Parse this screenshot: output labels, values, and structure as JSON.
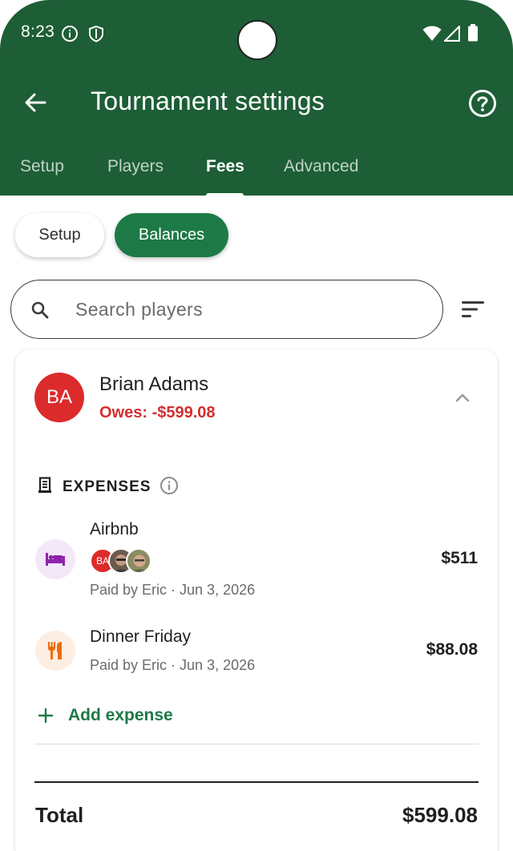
{
  "status_bar": {
    "time": "8:23"
  },
  "app_bar": {
    "title": "Tournament settings"
  },
  "tabs": [
    {
      "label": "Setup",
      "active": false
    },
    {
      "label": "Players",
      "active": false
    },
    {
      "label": "Fees",
      "active": true
    },
    {
      "label": "Advanced",
      "active": false
    }
  ],
  "segments": [
    {
      "label": "Setup",
      "selected": false
    },
    {
      "label": "Balances",
      "selected": true
    }
  ],
  "search": {
    "placeholder": "Search players",
    "value": ""
  },
  "player": {
    "initials": "BA",
    "name": "Brian Adams",
    "owes": "Owes: -$599.08",
    "expanded": true
  },
  "expenses": {
    "heading": "EXPENSES",
    "items": [
      {
        "title": "Airbnb",
        "icon": "bed-icon",
        "participants": [
          "BA",
          "photo",
          "photo"
        ],
        "subtitle": "Paid by Eric · Jun 3, 2026",
        "amount": "$511"
      },
      {
        "title": "Dinner Friday",
        "icon": "restaurant-icon",
        "subtitle": "Paid by Eric · Jun 3, 2026",
        "amount": "$88.08"
      }
    ],
    "add_label": "Add expense"
  },
  "total": {
    "label": "Total",
    "value": "$599.08"
  },
  "colors": {
    "primary": "#1d5e36",
    "accent": "#1d7a46",
    "owes": "#d32f2f",
    "avatar": "#db2b2b",
    "bed_icon": "#8e24aa",
    "food_icon": "#ef6c00"
  }
}
